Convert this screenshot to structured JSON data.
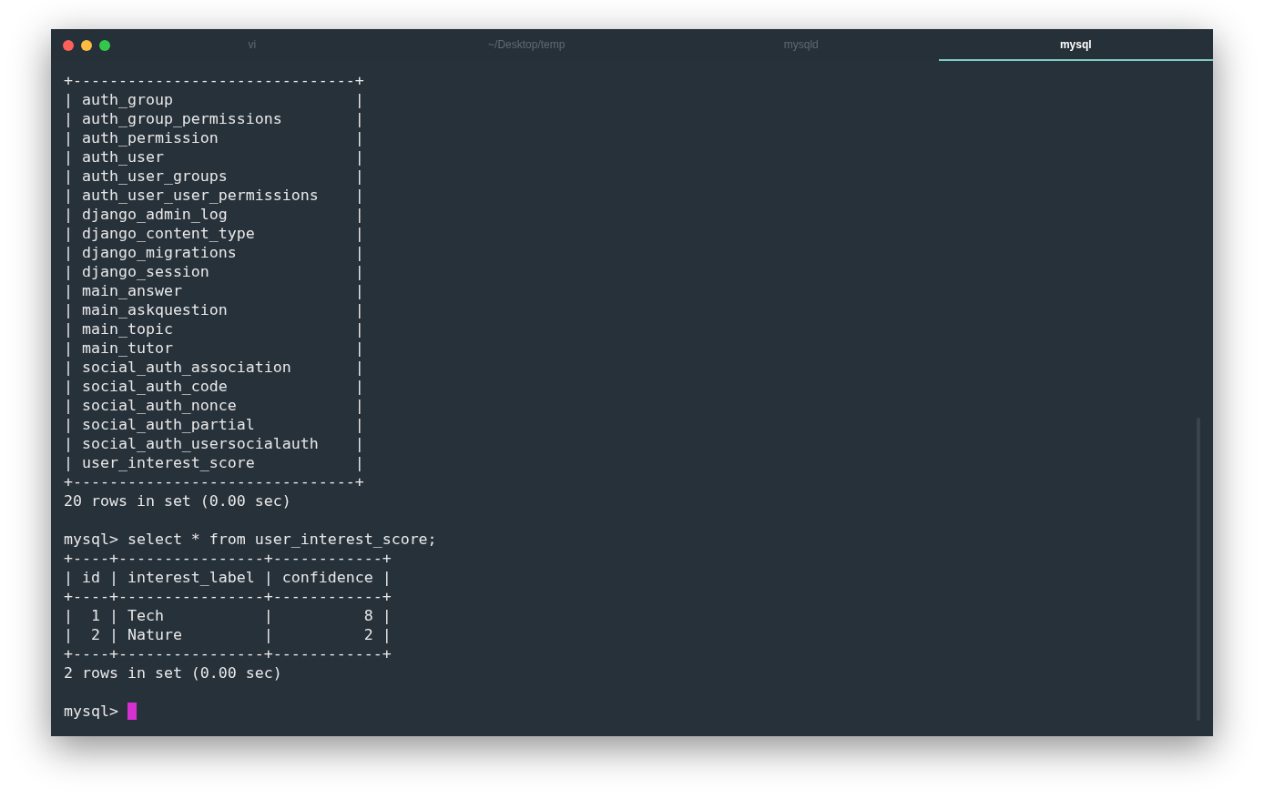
{
  "window": {
    "traffic_lights": [
      {
        "color": "#fc605b"
      },
      {
        "color": "#fdbc40"
      },
      {
        "color": "#34c84a"
      }
    ]
  },
  "tabs": [
    {
      "label": "vi",
      "selected": false
    },
    {
      "label": "~/Desktop/temp",
      "selected": false
    },
    {
      "label": "mysqld",
      "selected": false
    },
    {
      "label": "mysql",
      "selected": true
    }
  ],
  "terminal": {
    "blocks": [
      [
        "+-------------------------------+",
        "| auth_group                    |",
        "| auth_group_permissions        |",
        "| auth_permission               |",
        "| auth_user                     |",
        "| auth_user_groups              |",
        "| auth_user_user_permissions    |",
        "| django_admin_log              |",
        "| django_content_type           |",
        "| django_migrations             |",
        "| django_session                |",
        "| main_answer                   |",
        "| main_askquestion              |",
        "| main_topic                    |",
        "| main_tutor                    |",
        "| social_auth_association       |",
        "| social_auth_code              |",
        "| social_auth_nonce             |",
        "| social_auth_partial           |",
        "| social_auth_usersocialauth    |",
        "| user_interest_score           |",
        "+-------------------------------+",
        "20 rows in set (0.00 sec)"
      ],
      [
        "mysql> select * from user_interest_score;",
        "+----+----------------+------------+",
        "| id | interest_label | confidence |",
        "+----+----------------+------------+",
        "|  1 | Tech           |          8 |",
        "|  2 | Nature         |          2 |",
        "+----+----------------+------------+",
        "2 rows in set (0.00 sec)"
      ]
    ],
    "prompt": "mysql> "
  }
}
